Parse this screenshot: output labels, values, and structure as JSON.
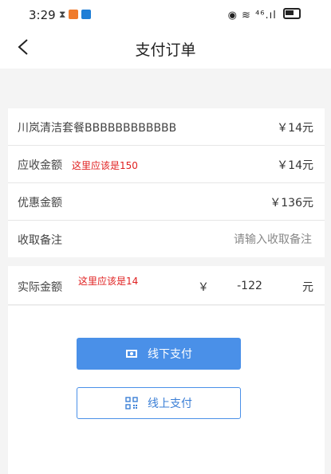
{
  "status_bar": {
    "time": "3:29",
    "right_icons": "◉ ≋ ⁴⁶.ıl"
  },
  "nav": {
    "title": "支付订单"
  },
  "rows": {
    "package": {
      "label": "川岚清洁套餐BBBBBBBBBBBB",
      "value": "￥14元"
    },
    "receivable": {
      "label": "应收金额",
      "note": "这里应该是150",
      "value": "￥14元"
    },
    "discount": {
      "label": "优惠金额",
      "value": "￥136元"
    },
    "remark": {
      "label": "收取备注",
      "placeholder": "请输入收取备注",
      "value": ""
    },
    "actual": {
      "label": "实际金额",
      "note": "这里应该是14",
      "currency": "￥",
      "value": "-122",
      "unit": "元"
    }
  },
  "buttons": {
    "offline": "线下支付",
    "online": "线上支付"
  },
  "colors": {
    "primary": "#4a90e8",
    "annotation": "#e02020"
  }
}
